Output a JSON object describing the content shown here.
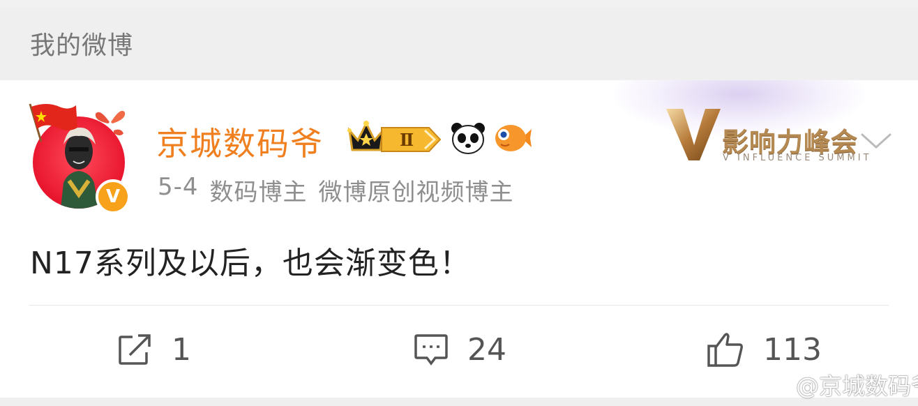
{
  "header": {
    "title": "我的微博"
  },
  "post": {
    "author": {
      "name": "京城数码爷",
      "verified_mark": "V",
      "level_badge": "Ⅱ"
    },
    "meta": {
      "date": "5-4",
      "tags": [
        "数码博主",
        "微博原创视频博主"
      ]
    },
    "event_banner": {
      "title": "影响力峰会",
      "subtitle": "V INFLUENCE SUMMIT"
    },
    "text": "N17系列及以后，也会渐变色！",
    "actions": {
      "repost_count": "1",
      "comment_count": "24",
      "like_count": "113"
    }
  },
  "watermark": {
    "text": "@京城数码爷"
  },
  "icons": {
    "flag": "china-flag-icon",
    "crown": "crown-icon",
    "panda": "panda-icon",
    "fish": "fish-icon",
    "repost": "repost-icon",
    "comment": "comment-icon",
    "like": "thumbs-up-icon",
    "more": "chevron-down-icon"
  },
  "colors": {
    "username": "#f07f1f",
    "verified": "#f7a21a",
    "avatar_bg": "#e8152d",
    "event_gold": "#b58a52"
  }
}
